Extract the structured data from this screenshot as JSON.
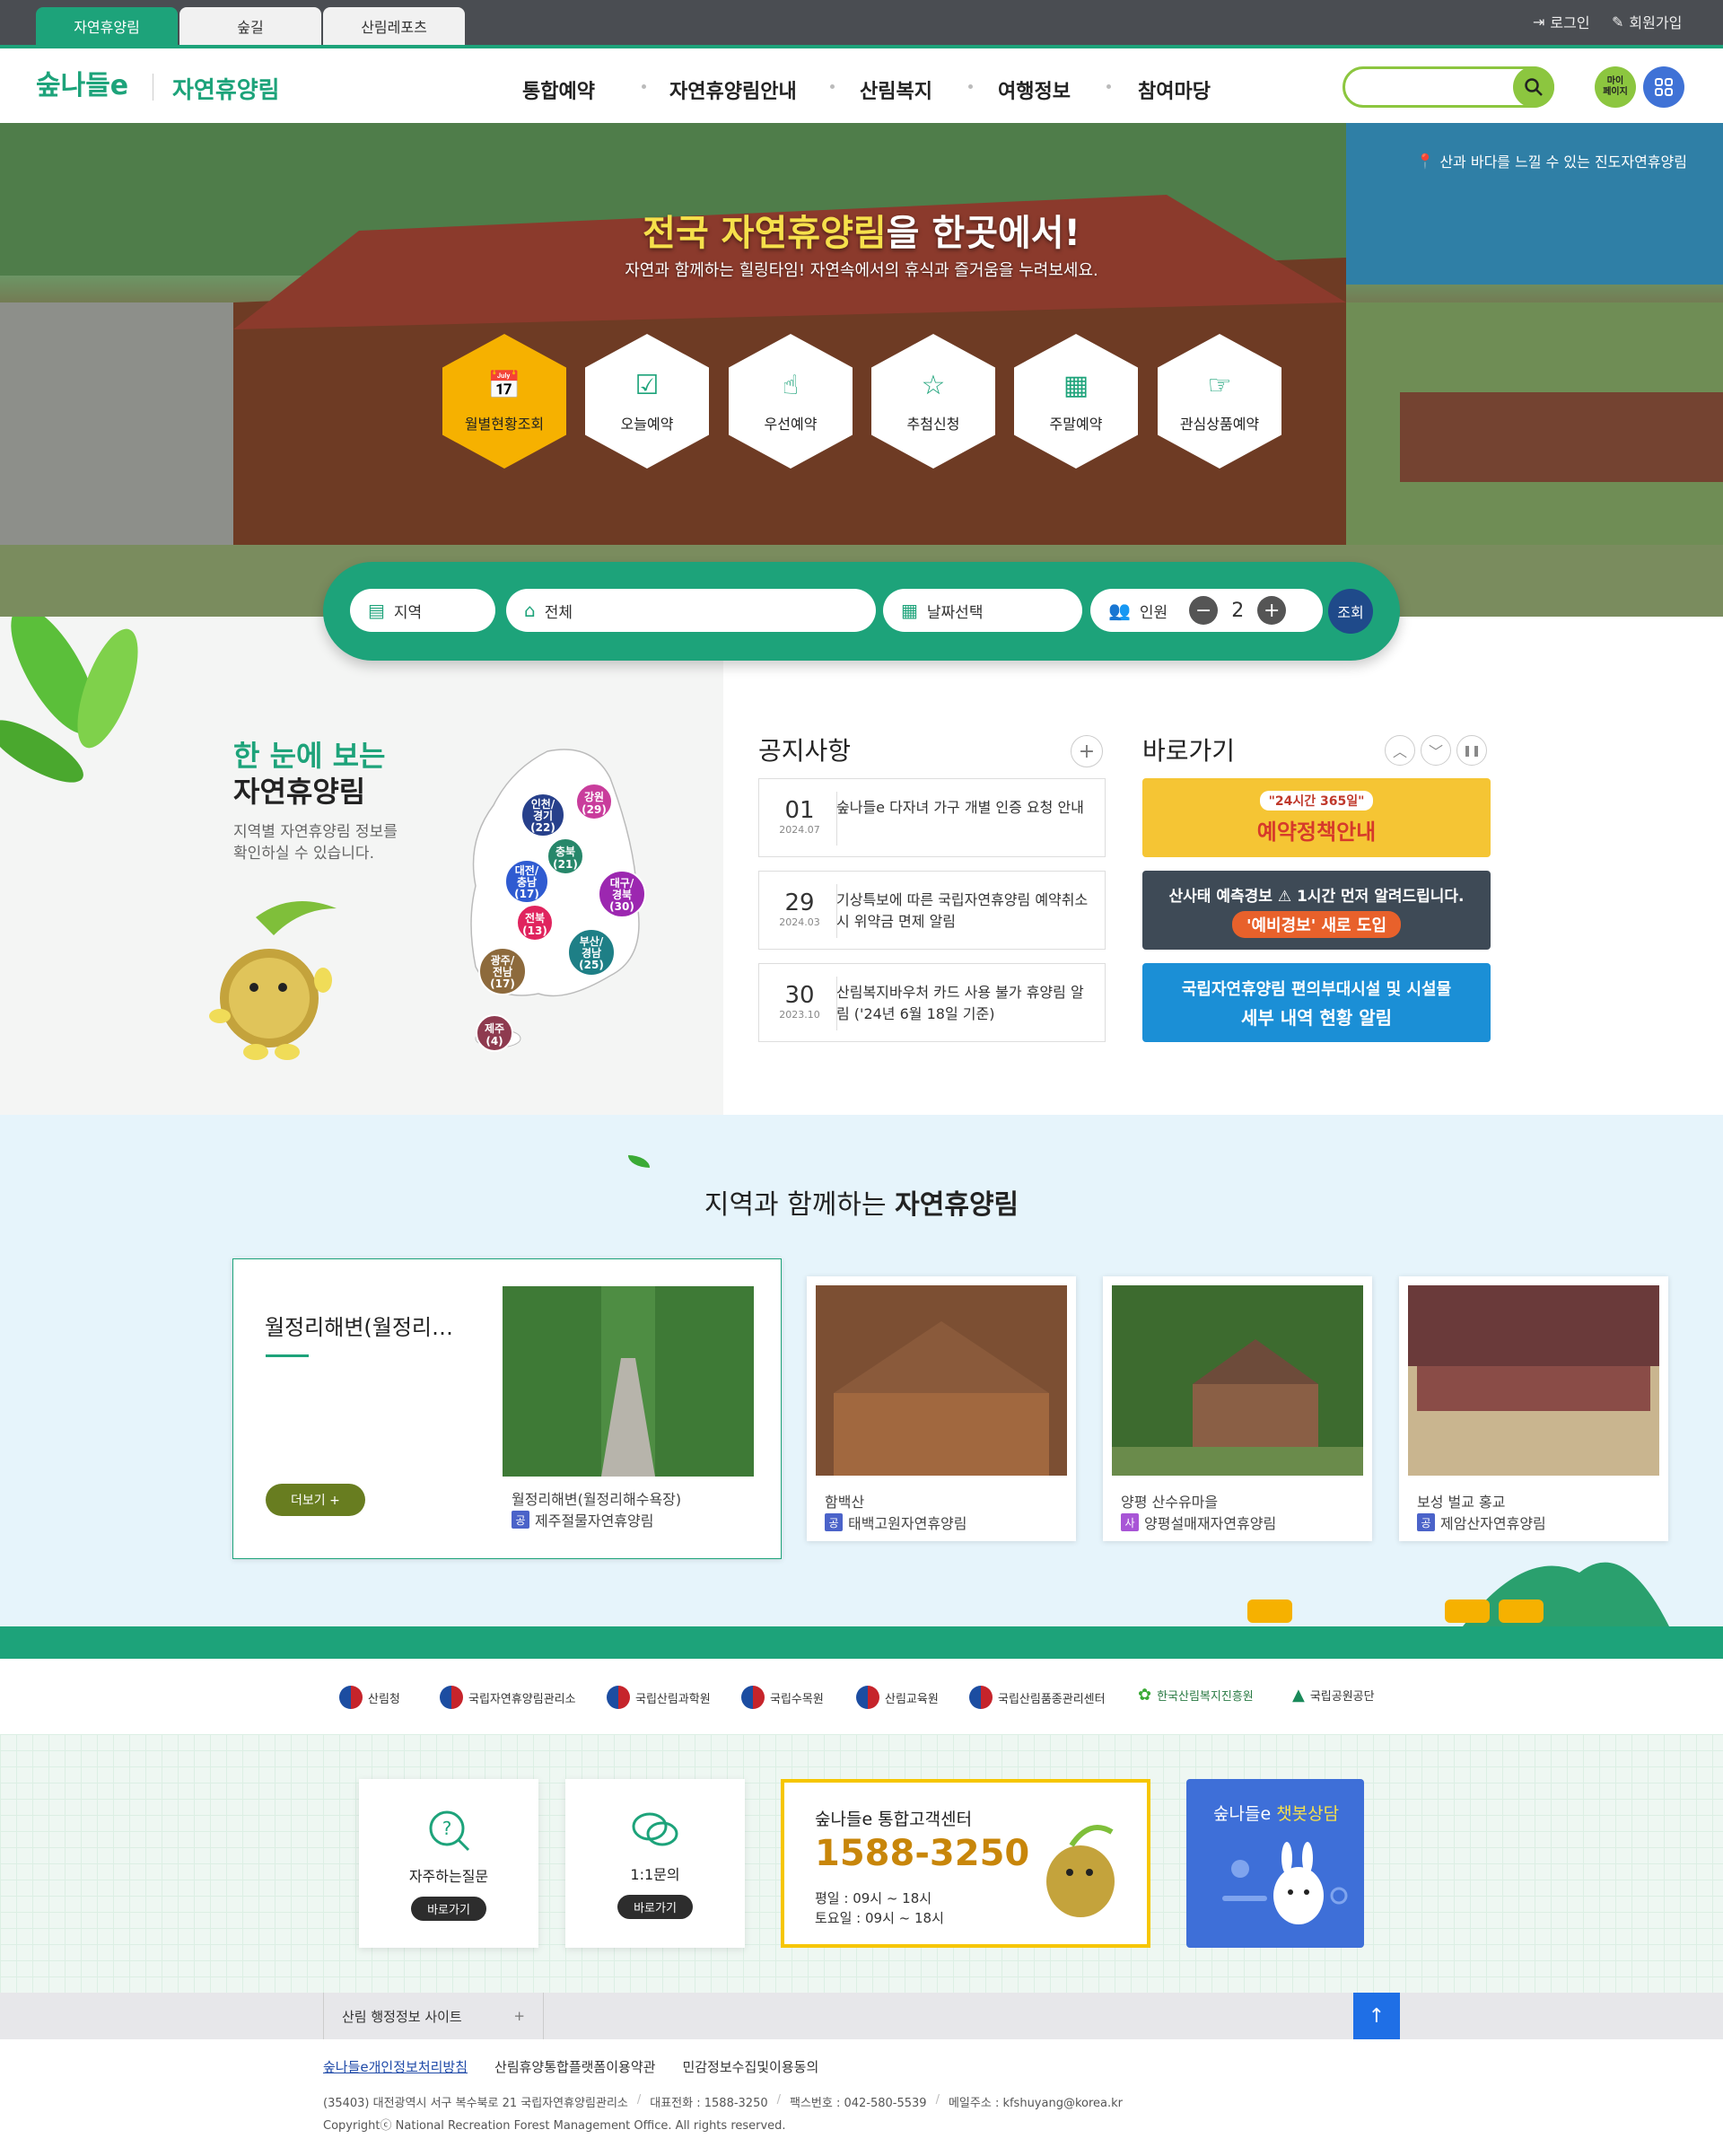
{
  "topbar": {
    "tabs": [
      {
        "label": "자연휴양림"
      },
      {
        "label": "숲길"
      },
      {
        "label": "산림레포츠"
      }
    ],
    "login": "로그인",
    "signup": "회원가입"
  },
  "header": {
    "logo_text": "숲나들e",
    "subtitle": "자연휴양림",
    "nav": [
      {
        "label": "통합예약"
      },
      {
        "label": "자연휴양림안내"
      },
      {
        "label": "산림복지"
      },
      {
        "label": "여행정보"
      },
      {
        "label": "참여마당"
      }
    ],
    "search_placeholder": "",
    "mypage": "마이\n페이지"
  },
  "hero": {
    "location": "산과 바다를 느낄 수 있는 진도자연휴양림",
    "title_highlight": "전국 자연휴양림",
    "title_rest": "을 한곳에서!",
    "tagline": "자연과 함께하는 힐링타임! 자연속에서의 휴식과 즐거움을 누려보세요.",
    "quick": [
      {
        "label": "월별현황조회"
      },
      {
        "label": "오늘예약"
      },
      {
        "label": "우선예약"
      },
      {
        "label": "추첨신청"
      },
      {
        "label": "주말예약"
      },
      {
        "label": "관심상품예약"
      }
    ]
  },
  "search": {
    "region": "지역",
    "forest": "전체",
    "date": "날짜선택",
    "people_label": "인원",
    "people_count": "2",
    "submit": "조회"
  },
  "map_section": {
    "title_green": "한 눈에 보는",
    "title_black": "자연휴양림",
    "desc": "지역별 자연휴양림 정보를\n확인하실 수 있습니다.",
    "regions": [
      {
        "label": "인천/\n경기\n(22)",
        "color": "#27408b"
      },
      {
        "label": "강원\n(29)",
        "color": "#c93d9c"
      },
      {
        "label": "충북\n(21)",
        "color": "#27876a"
      },
      {
        "label": "대전/\n충남\n(17)",
        "color": "#2f5bd1"
      },
      {
        "label": "대구/\n경북\n(30)",
        "color": "#9c27b0"
      },
      {
        "label": "전북\n(13)",
        "color": "#e0245e"
      },
      {
        "label": "부산/\n경남\n(25)",
        "color": "#1e7f86"
      },
      {
        "label": "광주/\n전남\n(17)",
        "color": "#8d6a3c"
      },
      {
        "label": "제주\n(4)",
        "color": "#8e3a4f"
      }
    ]
  },
  "notice": {
    "title": "공지사항",
    "items": [
      {
        "day": "01",
        "ym": "2024.07",
        "text": "숲나들e 다자녀 가구 개별 인증 요청 안내"
      },
      {
        "day": "29",
        "ym": "2024.03",
        "text": "기상특보에 따른 국립자연휴양림 예약취소 시 위약금 면제 알림"
      },
      {
        "day": "30",
        "ym": "2023.10",
        "text": "산림복지바우처 카드 사용 불가 휴양림 알림 ('24년 6월 18일 기준)"
      }
    ]
  },
  "shortcut": {
    "title": "바로가기",
    "banners": [
      {
        "line1": "\"24시간 365일\"",
        "line2": "예약정책안내",
        "bg": "#f5c534"
      },
      {
        "line1": "산사태 예측경보 ⚠ 1시간 먼저 알려드립니다.",
        "line2": "'예비경보' 새로 도입",
        "bg": "#3e4a56"
      },
      {
        "line1": "국립자연휴양림 편의부대시설 및 시설물",
        "line2": "세부 내역 현황 알림",
        "bg": "#1b8fd6"
      }
    ]
  },
  "region_section": {
    "title_normal": "지역과 함께하는",
    "title_bold": "자연휴양림",
    "featured": {
      "title": "월정리해변(월정리…",
      "more": "더보기 +",
      "caption": "월정리해변(월정리해수욕장)",
      "badge": "공",
      "forest": "제주절물자연휴양림"
    },
    "cards": [
      {
        "caption": "함백산",
        "badge": "공",
        "forest": "태백고원자연휴양림"
      },
      {
        "caption": "양평 산수유마을",
        "badge": "사",
        "forest": "양평설매재자연휴양림"
      },
      {
        "caption": "보성 벌교 홍교",
        "badge": "공",
        "forest": "제암산자연휴양림"
      }
    ]
  },
  "orgs": [
    {
      "name": "산림청"
    },
    {
      "name": "국립자연휴양림관리소"
    },
    {
      "name": "국립산림과학원"
    },
    {
      "name": "국립수목원"
    },
    {
      "name": "산림교육원"
    },
    {
      "name": "국립산림품종관리센터"
    },
    {
      "name": "한국산림복지진흥원"
    },
    {
      "name": "국립공원공단"
    }
  ],
  "help": {
    "faq": {
      "label": "자주하는질문",
      "btn": "바로가기"
    },
    "qna": {
      "label": "1:1문의",
      "btn": "바로가기"
    },
    "center": {
      "title": "숲나들e 통합고객센터",
      "phone": "1588-3250",
      "weekday": "평일 : 09시 ~ 18시",
      "saturday": "토요일 : 09시 ~ 18시"
    },
    "chatbot": {
      "prefix": "숲나들e",
      "highlight": "챗봇상담"
    }
  },
  "sitebar": {
    "label": "산림 행정정보 사이트",
    "plus": "+"
  },
  "footer": {
    "links": [
      {
        "label": "숲나들e개인정보처리방침"
      },
      {
        "label": "산림휴양통합플랫폼이용약관"
      },
      {
        "label": "민감정보수집및이용동의"
      }
    ],
    "address": "(35403) 대전광역시 서구 복수북로 21 국립자연휴양림관리소",
    "phone": "대표전화 : 1588-3250",
    "fax": "팩스번호 : 042-580-5539",
    "email": "메일주소 : kfshuyang@korea.kr",
    "copyright": "Copyrightⓒ National Recreation Forest Management Office. All rights reserved."
  },
  "colors": {
    "brand": "#1da37a",
    "accent": "#f6b100",
    "dark": "#4a4d52"
  }
}
